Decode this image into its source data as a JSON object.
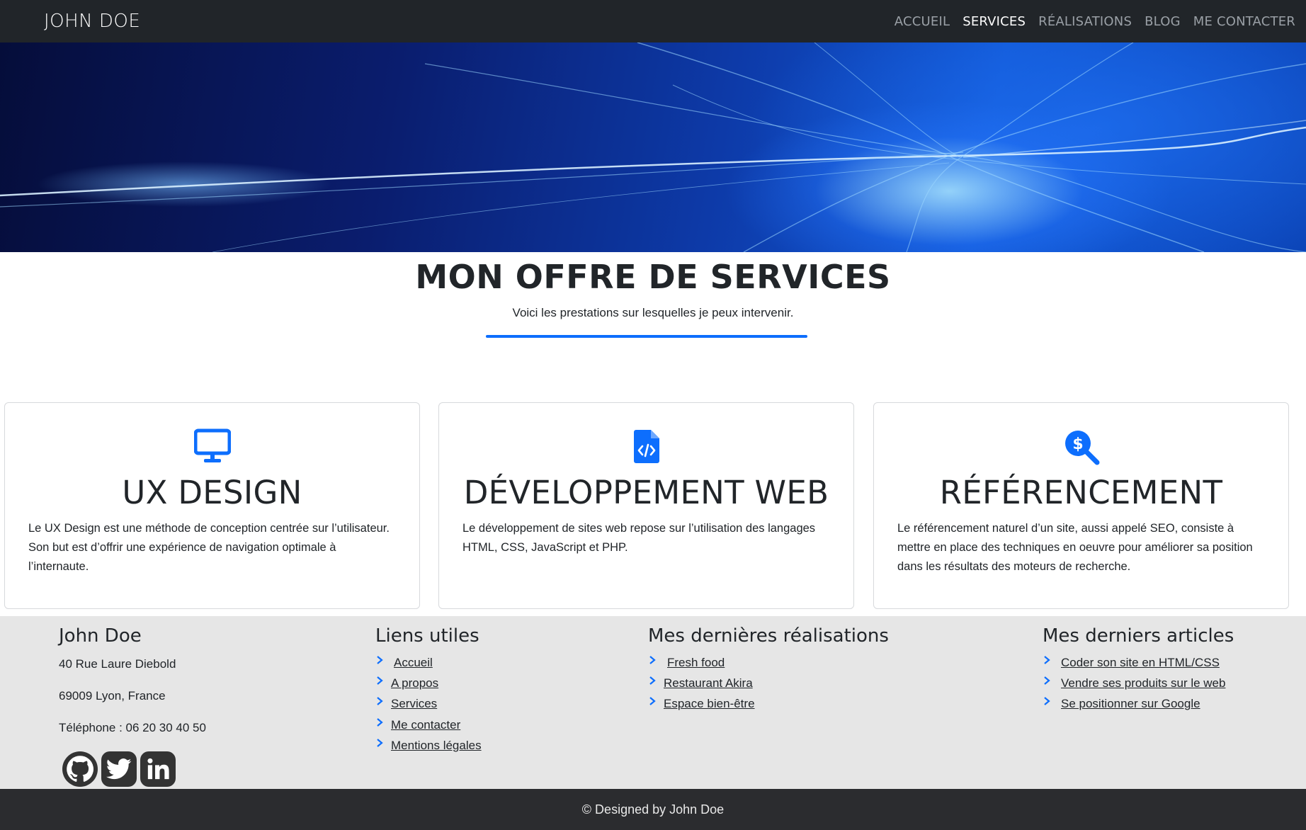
{
  "navbar": {
    "brand": "JOHN DOE",
    "items": [
      {
        "label": "ACCUEIL",
        "active": false
      },
      {
        "label": "SERVICES",
        "active": true
      },
      {
        "label": "RÉALISATIONS",
        "active": false
      },
      {
        "label": "BLOG",
        "active": false
      },
      {
        "label": "ME CONTACTER",
        "active": false
      }
    ]
  },
  "hero": {
    "image": "blue-light-streaks-banner"
  },
  "services": {
    "title": "MON OFFRE DE SERVICES",
    "subtitle": "Voici les prestations sur lesquelles je peux intervenir.",
    "cards": [
      {
        "icon": "monitor-icon",
        "title": "UX DESIGN",
        "text": "Le UX Design est une méthode de conception centrée sur l’utilisateur. Son but est d’offrir une expérience de navigation optimale à l’internaute."
      },
      {
        "icon": "file-code-icon",
        "title": "DÉVELOPPEMENT WEB",
        "text": "Le développement de sites web repose sur l’utilisation des langages HTML, CSS, JavaScript et PHP."
      },
      {
        "icon": "search-dollar-icon",
        "title": "RÉFÉRENCEMENT",
        "text": "Le référencement naturel d’un site, aussi appelé SEO, consiste à mettre en place des techniques en oeuvre pour améliorer sa position dans les résultats des moteurs de recherche."
      }
    ]
  },
  "footer": {
    "contact": {
      "name": "John Doe",
      "street": "40 Rue Laure Diebold",
      "city": "69009 Lyon, France",
      "phone": "Téléphone : 06 20 30 40 50",
      "social": [
        "github-icon",
        "twitter-icon",
        "linkedin-icon"
      ]
    },
    "useful_links": {
      "title": "Liens utiles",
      "items": [
        "Accueil",
        "A propos",
        "Services",
        "Me contacter",
        "Mentions légales"
      ]
    },
    "realisations": {
      "title": "Mes dernières réalisations",
      "items": [
        "Fresh food",
        "Restaurant Akira",
        "Espace bien-être"
      ]
    },
    "articles": {
      "title": "Mes derniers articles",
      "items": [
        "Coder son site en HTML/CSS",
        "Vendre ses produits sur le web",
        "Se positionner sur Google"
      ]
    }
  },
  "copyright": "© Designed by John Doe",
  "colors": {
    "accent": "#0d6efd",
    "navbar": "#212529",
    "footer": "#e6e6e6",
    "bottombar": "#2b2c2f"
  }
}
